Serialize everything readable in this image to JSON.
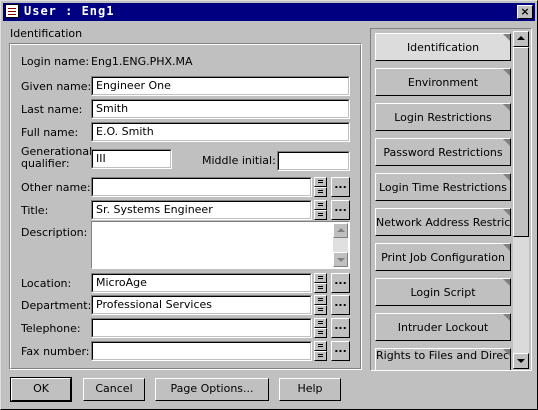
{
  "window": {
    "title": "User : Eng1",
    "close_label": "×"
  },
  "identification": {
    "section_label": "Identification",
    "login_name_label": "Login name:",
    "login_name": "Eng1.ENG.PHX.MA",
    "given_name_label": "Given name:",
    "given_name": "Engineer One",
    "last_name_label": "Last name:",
    "last_name": "Smith",
    "full_name_label": "Full name:",
    "full_name": "E.O. Smith",
    "gen_qualifier_label_1": "Generational",
    "gen_qualifier_label_2": "qualifier:",
    "gen_qualifier": "III",
    "middle_initial_label": "Middle initial:",
    "middle_initial": "",
    "other_name_label": "Other name:",
    "other_name": "",
    "title_label": "Title:",
    "title": "Sr. Systems Engineer",
    "description_label": "Description:",
    "description": "",
    "location_label": "Location:",
    "location": "MicroAge",
    "department_label": "Department:",
    "department": "Professional Services",
    "telephone_label": "Telephone:",
    "telephone": "",
    "fax_label": "Fax number:",
    "fax": "",
    "ellipsis": "..."
  },
  "pages": [
    "Identification",
    "Environment",
    "Login Restrictions",
    "Password Restrictions",
    "Login Time Restrictions",
    "Network Address Restriction",
    "Print Job Configuration",
    "Login Script",
    "Intruder Lockout",
    "Rights to Files and Directories"
  ],
  "buttons": {
    "ok": "OK",
    "cancel": "Cancel",
    "page_options": "Page Options...",
    "help": "Help"
  }
}
